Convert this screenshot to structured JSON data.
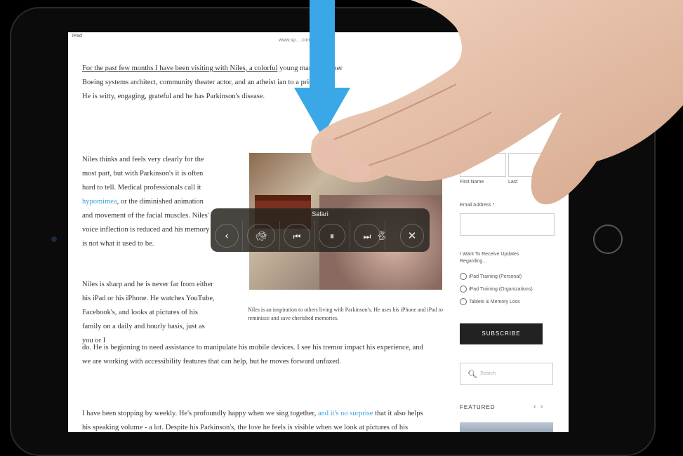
{
  "status": {
    "device": "iPad",
    "url": "www.sp….com"
  },
  "article": {
    "p1_underlined": "For the past few months I have been visiting with Niles, a colorful",
    "p1_hidden": "young man. A former",
    "p1_line2": "Boeing systems architect, community theater actor, and an atheist",
    "p1_line2b": "ian to a priest - he",
    "p1_line3": "He is witty, engaging, grateful and he has Parkinson's disease.",
    "p2": "Niles thinks and feels very clearly for the most part, but with Parkinson's it is often hard to tell. Medical professionals call it",
    "p2_link": "hypomimea",
    "p2_rest": ", or the diminished animation and movement of the facial muscles. Niles' voice inflection is reduced and his memory is not what it used to be.",
    "p3": "Niles is sharp and he is never far from either his iPad or his iPhone. He watches YouTube, Facebook's, and looks at pictures of his family on a daily and hourly basis, just as you or I",
    "p4": "do. He is beginning to need assistance to manipulate his mobile devices. I see his tremor impact his experience, and we are working with accessibility features that can help, but he moves forward unfazed.",
    "p5a": "I have been stopping by weekly. He's profoundly happy when we sing together,",
    "p5_link": "and it's no surprise",
    "p5b": "that it also helps his speaking volume - a lot. Despite his Parkinson's, the love he feels is visible when we look at pictures of his family. He delights in watching clips of plays (many of which he once starred in) on YouTube and reminiscing together.",
    "caption": "Niles is an inspiration to others living with Parkinson's. He uses his iPhone and iPad to reminisce and save cherished memories."
  },
  "sidebar": {
    "first_name": "First Name",
    "last_name": "Last",
    "email_label": "Email Address *",
    "updates_label": "I Want To Receive Updates Regarding...",
    "options": [
      "iPad Training (Personal)",
      "iPad Training (Organizations)",
      "Tablets & Memory Loss"
    ],
    "subscribe": "SUBSCRIBE",
    "search_placeholder": "Search",
    "featured": "FEATURED"
  },
  "switcher": {
    "app_label": "Safari"
  },
  "colors": {
    "arrow": "#3aa8e6",
    "link": "#3aa0e0"
  }
}
